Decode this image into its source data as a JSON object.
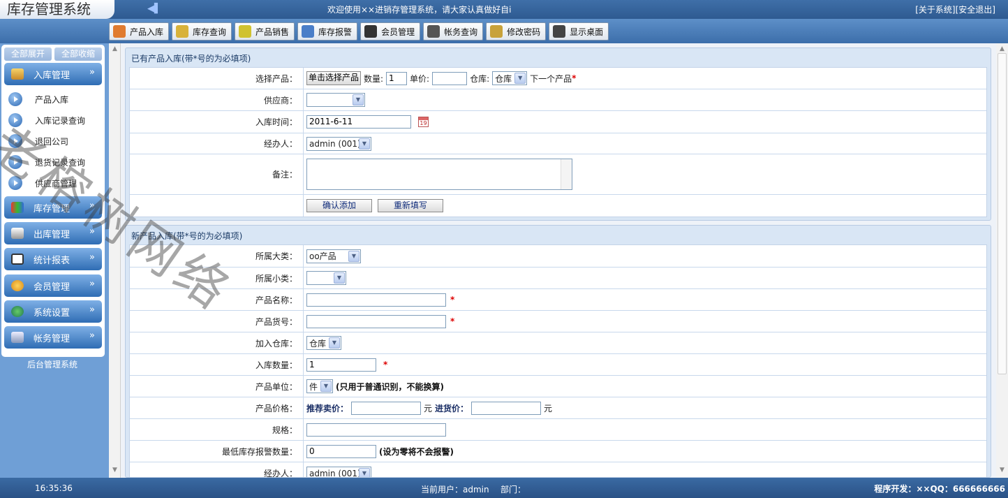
{
  "header": {
    "logo": "库存管理系统",
    "welcome": "欢迎使用××进销存管理系统，请大家认真做好自i",
    "links": [
      "[关于系统]",
      "[安全退出]"
    ]
  },
  "nav": [
    {
      "label": "产品入库",
      "icon": "box-in-icon",
      "color": "#e07b2f"
    },
    {
      "label": "库存查询",
      "icon": "folder-icon",
      "color": "#d8b23a"
    },
    {
      "label": "产品销售",
      "icon": "tag-icon",
      "color": "#d0c230"
    },
    {
      "label": "库存报警",
      "icon": "speaker-icon",
      "color": "#4a7ec8"
    },
    {
      "label": "会员管理",
      "icon": "member-icon",
      "color": "#333333"
    },
    {
      "label": "帐务查询",
      "icon": "clipboard-icon",
      "color": "#555555"
    },
    {
      "label": "修改密码",
      "icon": "key-icon",
      "color": "#c8a23a"
    },
    {
      "label": "显示桌面",
      "icon": "desktop-icon",
      "color": "#444444"
    }
  ],
  "sidebar": {
    "expand_all": "全部展开",
    "collapse_all": "全部收缩",
    "groups": [
      {
        "label": "入库管理",
        "icon": "stock-in-icon"
      },
      {
        "label": "库存管理",
        "icon": "inventory-icon"
      },
      {
        "label": "出库管理",
        "icon": "stock-out-icon"
      },
      {
        "label": "统计报表",
        "icon": "report-icon"
      },
      {
        "label": "会员管理",
        "icon": "member-icon"
      },
      {
        "label": "系统设置",
        "icon": "settings-icon"
      },
      {
        "label": "帐务管理",
        "icon": "accounts-icon"
      }
    ],
    "subitems": [
      "产品入库",
      "入库记录查询",
      "退回公司",
      "退货记录查询",
      "供应商管理"
    ],
    "chevron": "»",
    "footer": "后台管理系统"
  },
  "panel1": {
    "title": "已有产品入库(带*号的为必填项)",
    "row_product": {
      "label": "选择产品：",
      "pick_btn": "单击选择产品",
      "qty_label": "数量:",
      "qty_value": "1",
      "price_label": "单价:",
      "price_value": "",
      "wh_label": "仓库:",
      "wh_value": "仓库",
      "next_label": "下一个产品"
    },
    "row_supplier": {
      "label": "供应商：",
      "value": ""
    },
    "row_time": {
      "label": "入库时间：",
      "value": "2011-6-11",
      "cal_text": "19"
    },
    "row_handler": {
      "label": "经办人：",
      "value": "admin (001)"
    },
    "row_note": {
      "label": "备注："
    },
    "btn_confirm": "确认添加",
    "btn_reset": "重新填写"
  },
  "panel2": {
    "title": "新产品入库(带*号的为必填项)",
    "row_cat": {
      "label": "所属大类：",
      "value": "oo产品"
    },
    "row_subcat": {
      "label": "所属小类：",
      "value": ""
    },
    "row_name": {
      "label": "产品名称：",
      "value": ""
    },
    "row_code": {
      "label": "产品货号：",
      "value": ""
    },
    "row_wh": {
      "label": "加入仓库：",
      "value": "仓库"
    },
    "row_qty": {
      "label": "入库数量：",
      "value": "1"
    },
    "row_unit": {
      "label": "产品单位：",
      "value": "件",
      "note": "(只用于普通识别，不能换算)"
    },
    "row_price": {
      "label": "产品价格：",
      "sell_label": "推荐卖价：",
      "sell_value": "",
      "unit1": "元",
      "buy_label": "进货价：",
      "buy_value": "",
      "unit2": "元"
    },
    "row_spec": {
      "label": "规格：",
      "value": ""
    },
    "row_alarm": {
      "label": "最低库存报警数量：",
      "value": "0",
      "note": "(设为零将不会报警)"
    },
    "row_handler": {
      "label": "经办人：",
      "value": "admin (001)"
    }
  },
  "status": {
    "time": "16:35:36",
    "user": "当前用户：admin",
    "dept": "部门：",
    "dev": "程序开发：××QQ：666666666"
  },
  "watermark": "老榕树网络",
  "required_mark": "*",
  "dropdown_glyph": "▼"
}
